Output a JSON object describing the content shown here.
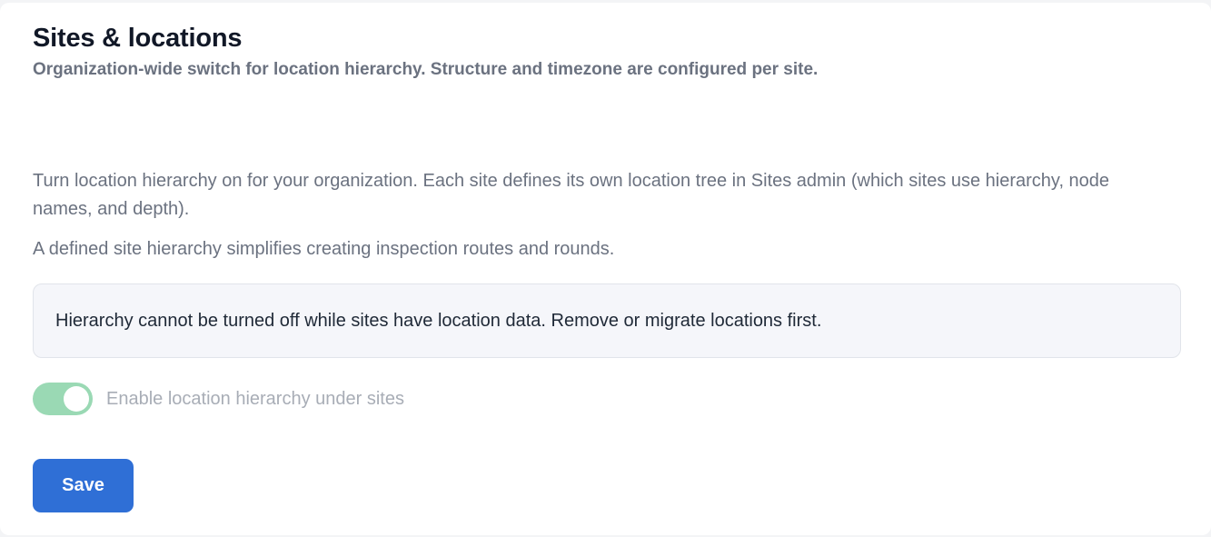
{
  "header": {
    "title": "Sites & locations",
    "subtitle": "Organization-wide switch for location hierarchy. Structure and timezone are configured per site."
  },
  "body": {
    "description": "Turn location hierarchy on for your organization. Each site defines its own location tree in Sites admin (which sites use hierarchy, node names, and depth).",
    "note": "A defined site hierarchy simplifies creating inspection routes and rounds."
  },
  "notice": {
    "text": "Hierarchy cannot be turned off while sites have location data. Remove or migrate locations first."
  },
  "toggle": {
    "label": "Enable location hierarchy under sites",
    "checked": true,
    "disabled": true,
    "color": "#9ad9b4"
  },
  "actions": {
    "save_label": "Save",
    "save_color": "#2f6fd6"
  }
}
